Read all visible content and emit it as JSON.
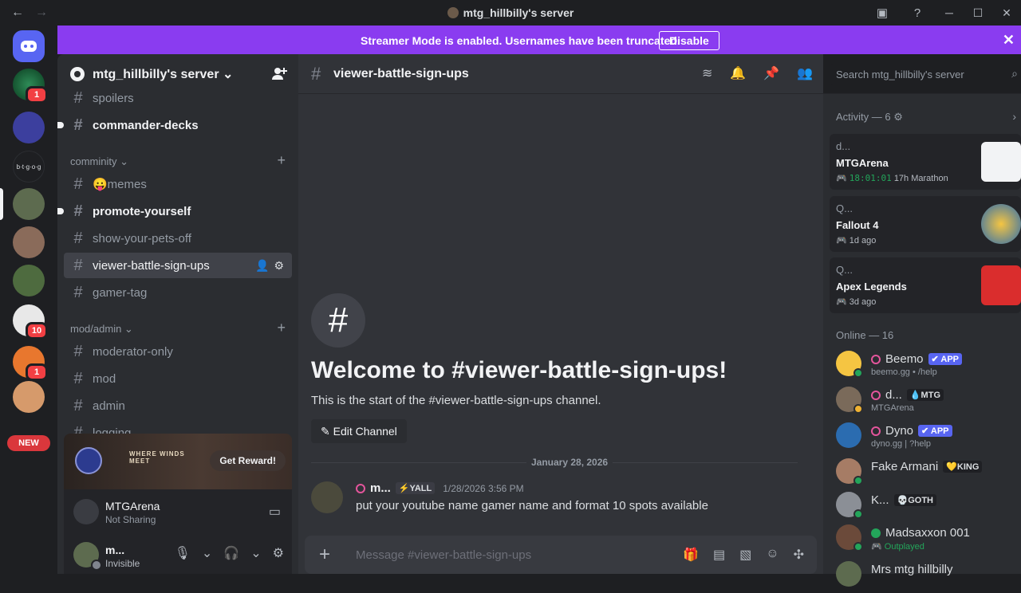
{
  "window": {
    "title": "mtg_hillbilly's server",
    "back": "←",
    "forward": "→",
    "minimize": "─",
    "maximize": "☐",
    "close": "✕"
  },
  "servers": {
    "badges": [
      "1",
      "10",
      "1"
    ],
    "small_label": "b·t·g·o·g",
    "new_label": "NEW"
  },
  "streamer_banner": {
    "message": "Streamer Mode is enabled. Usernames have been truncated.",
    "button": "Disable",
    "close": "✕"
  },
  "guild": {
    "name": "mtg_hillbilly's server ⌄"
  },
  "channels": {
    "top": [
      {
        "name": "spoilers"
      },
      {
        "name": "commander-decks"
      }
    ],
    "cat1": "comminity ⌄",
    "cat1_items": [
      {
        "name": "😛memes"
      },
      {
        "name": "promote-yourself"
      },
      {
        "name": "show-your-pets-off"
      },
      {
        "name": "viewer-battle-sign-ups"
      },
      {
        "name": "gamer-tag"
      }
    ],
    "cat2": "mod/admin ⌄",
    "cat2_items": [
      {
        "name": "moderator-only"
      },
      {
        "name": "mod"
      },
      {
        "name": "admin"
      },
      {
        "name": "logging"
      }
    ]
  },
  "promo": {
    "brand": "WHERE WINDS MEET",
    "button": "Get Reward!"
  },
  "voice": {
    "app": "MTGArena",
    "status": "Not Sharing"
  },
  "user": {
    "name": "m...",
    "status": "Invisible"
  },
  "chat": {
    "channel": "viewer-battle-sign-ups",
    "search_placeholder": "Search mtg_hillbilly's server",
    "welcome_title": "Welcome to #viewer-battle-sign-ups!",
    "welcome_sub": "This is the start of the #viewer-battle-sign-ups channel.",
    "edit_button": "Edit Channel",
    "date_divider": "January 28, 2026",
    "message": {
      "author": "m...",
      "tag": "⚡YALL",
      "timestamp": "1/28/2026 3:56 PM",
      "text": "put your youtube name gamer name and format 10 spots available"
    },
    "composer_placeholder": "Message #viewer-battle-sign-ups"
  },
  "activity": {
    "header": "Activity — 6 ⚙",
    "cards": [
      {
        "who": "d...",
        "game": "MTGArena",
        "time": "18:01:01",
        "extra": "17h Marathon"
      },
      {
        "who": "Q...",
        "game": "Fallout 4",
        "time": "1d ago"
      },
      {
        "who": "Q...",
        "game": "Apex Legends",
        "time": "3d ago"
      }
    ]
  },
  "online": {
    "header": "Online — 16",
    "members": [
      {
        "name": "Beemo",
        "tag": "✔ APP",
        "sub": "beemo.gg • /help"
      },
      {
        "name": "d...",
        "tag": "💧MTG",
        "sub": "MTGArena"
      },
      {
        "name": "Dyno",
        "tag": "✔ APP",
        "sub": "dyno.gg | ?help"
      },
      {
        "name": "Fake Armani",
        "tag": "💛KING",
        "sub": ""
      },
      {
        "name": "K...",
        "tag": "💀GOTH",
        "sub": ""
      },
      {
        "name": "Madsaxxon 001",
        "tag": "",
        "sub": "Outplayed"
      },
      {
        "name": "Mrs mtg hillbilly",
        "tag": "",
        "sub": ""
      }
    ]
  },
  "colors": {
    "accent": "#5865f2",
    "streamer": "#8a3cf0",
    "online": "#23a55a",
    "badge": "#f23f43"
  }
}
